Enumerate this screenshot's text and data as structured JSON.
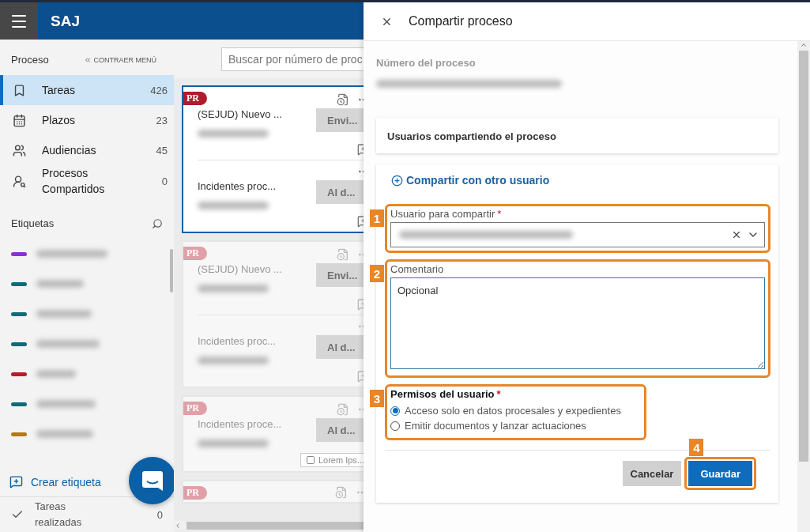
{
  "header": {
    "app_name": "SAJ"
  },
  "sidebar": {
    "section_title": "Proceso",
    "collapse_link": "CONTRAER MENÚ",
    "nav_items": [
      {
        "label": "Tareas",
        "count": "426",
        "selected": true
      },
      {
        "label": "Plazos",
        "count": "23",
        "selected": false
      },
      {
        "label": "Audiencias",
        "count": "45",
        "selected": false
      },
      {
        "label": "Procesos Compartidos",
        "count": "0",
        "selected": false
      }
    ],
    "tags_title": "Etiquetas",
    "tags": [
      {
        "color": "#8b2fd8"
      },
      {
        "color": "#0f6b78"
      },
      {
        "color": "#0f6b78"
      },
      {
        "color": "#0f6b78"
      },
      {
        "color": "#b3202a"
      },
      {
        "color": "#0f6b78"
      },
      {
        "color": "#b57a12"
      }
    ],
    "create_tag": "Crear etiqueta",
    "done": {
      "label": "Tareas realizadas",
      "count": "0"
    }
  },
  "search": {
    "placeholder": "Buscar por número de proc"
  },
  "cards": [
    {
      "badge": "PR",
      "selected": true,
      "entries": [
        {
          "title": "(SEJUD) Nuevo ...",
          "action": "Envi..."
        },
        {
          "title": "Incidentes proc...",
          "action": "Al d..."
        }
      ]
    },
    {
      "badge": "PR",
      "selected": false,
      "entries": [
        {
          "title": "(SEJUD) Nuevo ...",
          "action": "Envi..."
        },
        {
          "title": "Incidentes proc...",
          "action": "Al d..."
        }
      ]
    },
    {
      "badge": "PR",
      "selected": false,
      "entries": [
        {
          "title": "Incidentes proce...",
          "action": "Al d...",
          "chip": "Lorem Ips..."
        }
      ]
    },
    {
      "badge": "PR",
      "selected": false
    }
  ],
  "drawer": {
    "title": "Compartir proceso",
    "process_number_label": "Número del proceso",
    "users_section": "Usuarios compartiendo el proceso",
    "share_link": "Compartir con otro usuario",
    "user_field": {
      "label": "Usuario para compartir",
      "required_mark": "*",
      "annotation": "1"
    },
    "comment_field": {
      "label": "Comentario",
      "placeholder": "Opcional",
      "annotation": "2"
    },
    "permissions": {
      "label": "Permisos del usuario",
      "required_mark": "*",
      "annotation": "3",
      "options": [
        {
          "label": "Acceso solo en datos procesales y expedientes",
          "selected": true
        },
        {
          "label": "Emitir documentos y lanzar actuaciones",
          "selected": false
        }
      ]
    },
    "buttons": {
      "cancel": "Cancelar",
      "save": "Guardar",
      "annotation": "4"
    }
  }
}
